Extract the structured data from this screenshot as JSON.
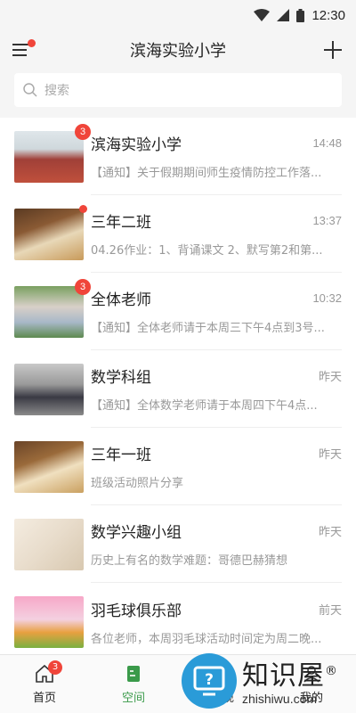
{
  "status": {
    "time": "12:30"
  },
  "header": {
    "title": "滨海实验小学"
  },
  "search": {
    "placeholder": "搜索"
  },
  "chats": [
    {
      "name": "滨海实验小学",
      "time": "14:48",
      "preview": "【通知】关于假期期间师生疫情防控工作落...",
      "badge": "3",
      "thumb": "campus"
    },
    {
      "name": "三年二班",
      "time": "13:37",
      "preview": "04.26作业：1、背诵课文 2、默写第2和第...",
      "badge": "",
      "thumb": "books"
    },
    {
      "name": "全体老师",
      "time": "10:32",
      "preview": "【通知】全体老师请于本周三下午4点到3号...",
      "badge": "3",
      "thumb": "group"
    },
    {
      "name": "数学科组",
      "time": "昨天",
      "preview": "【通知】全体数学老师请于本周四下午4点...",
      "badge": "",
      "thumb": "team"
    },
    {
      "name": "三年一班",
      "time": "昨天",
      "preview": "班级活动照片分享",
      "badge": "",
      "thumb": "books"
    },
    {
      "name": "数学兴趣小组",
      "time": "昨天",
      "preview": "历史上有名的数学难题：哥德巴赫猜想",
      "badge": "",
      "thumb": "paper"
    },
    {
      "name": "羽毛球俱乐部",
      "time": "前天",
      "preview": "各位老师，本周羽毛球活动时间定为周二晚...",
      "badge": "",
      "thumb": "sport"
    }
  ],
  "tabs": [
    {
      "label": "首页",
      "badge": "3"
    },
    {
      "label": "空间"
    },
    {
      "label": "发现"
    },
    {
      "label": "我的"
    }
  ],
  "watermark": {
    "title": "知识屋",
    "sub": "zhishiwu.com",
    "mark": "®"
  }
}
